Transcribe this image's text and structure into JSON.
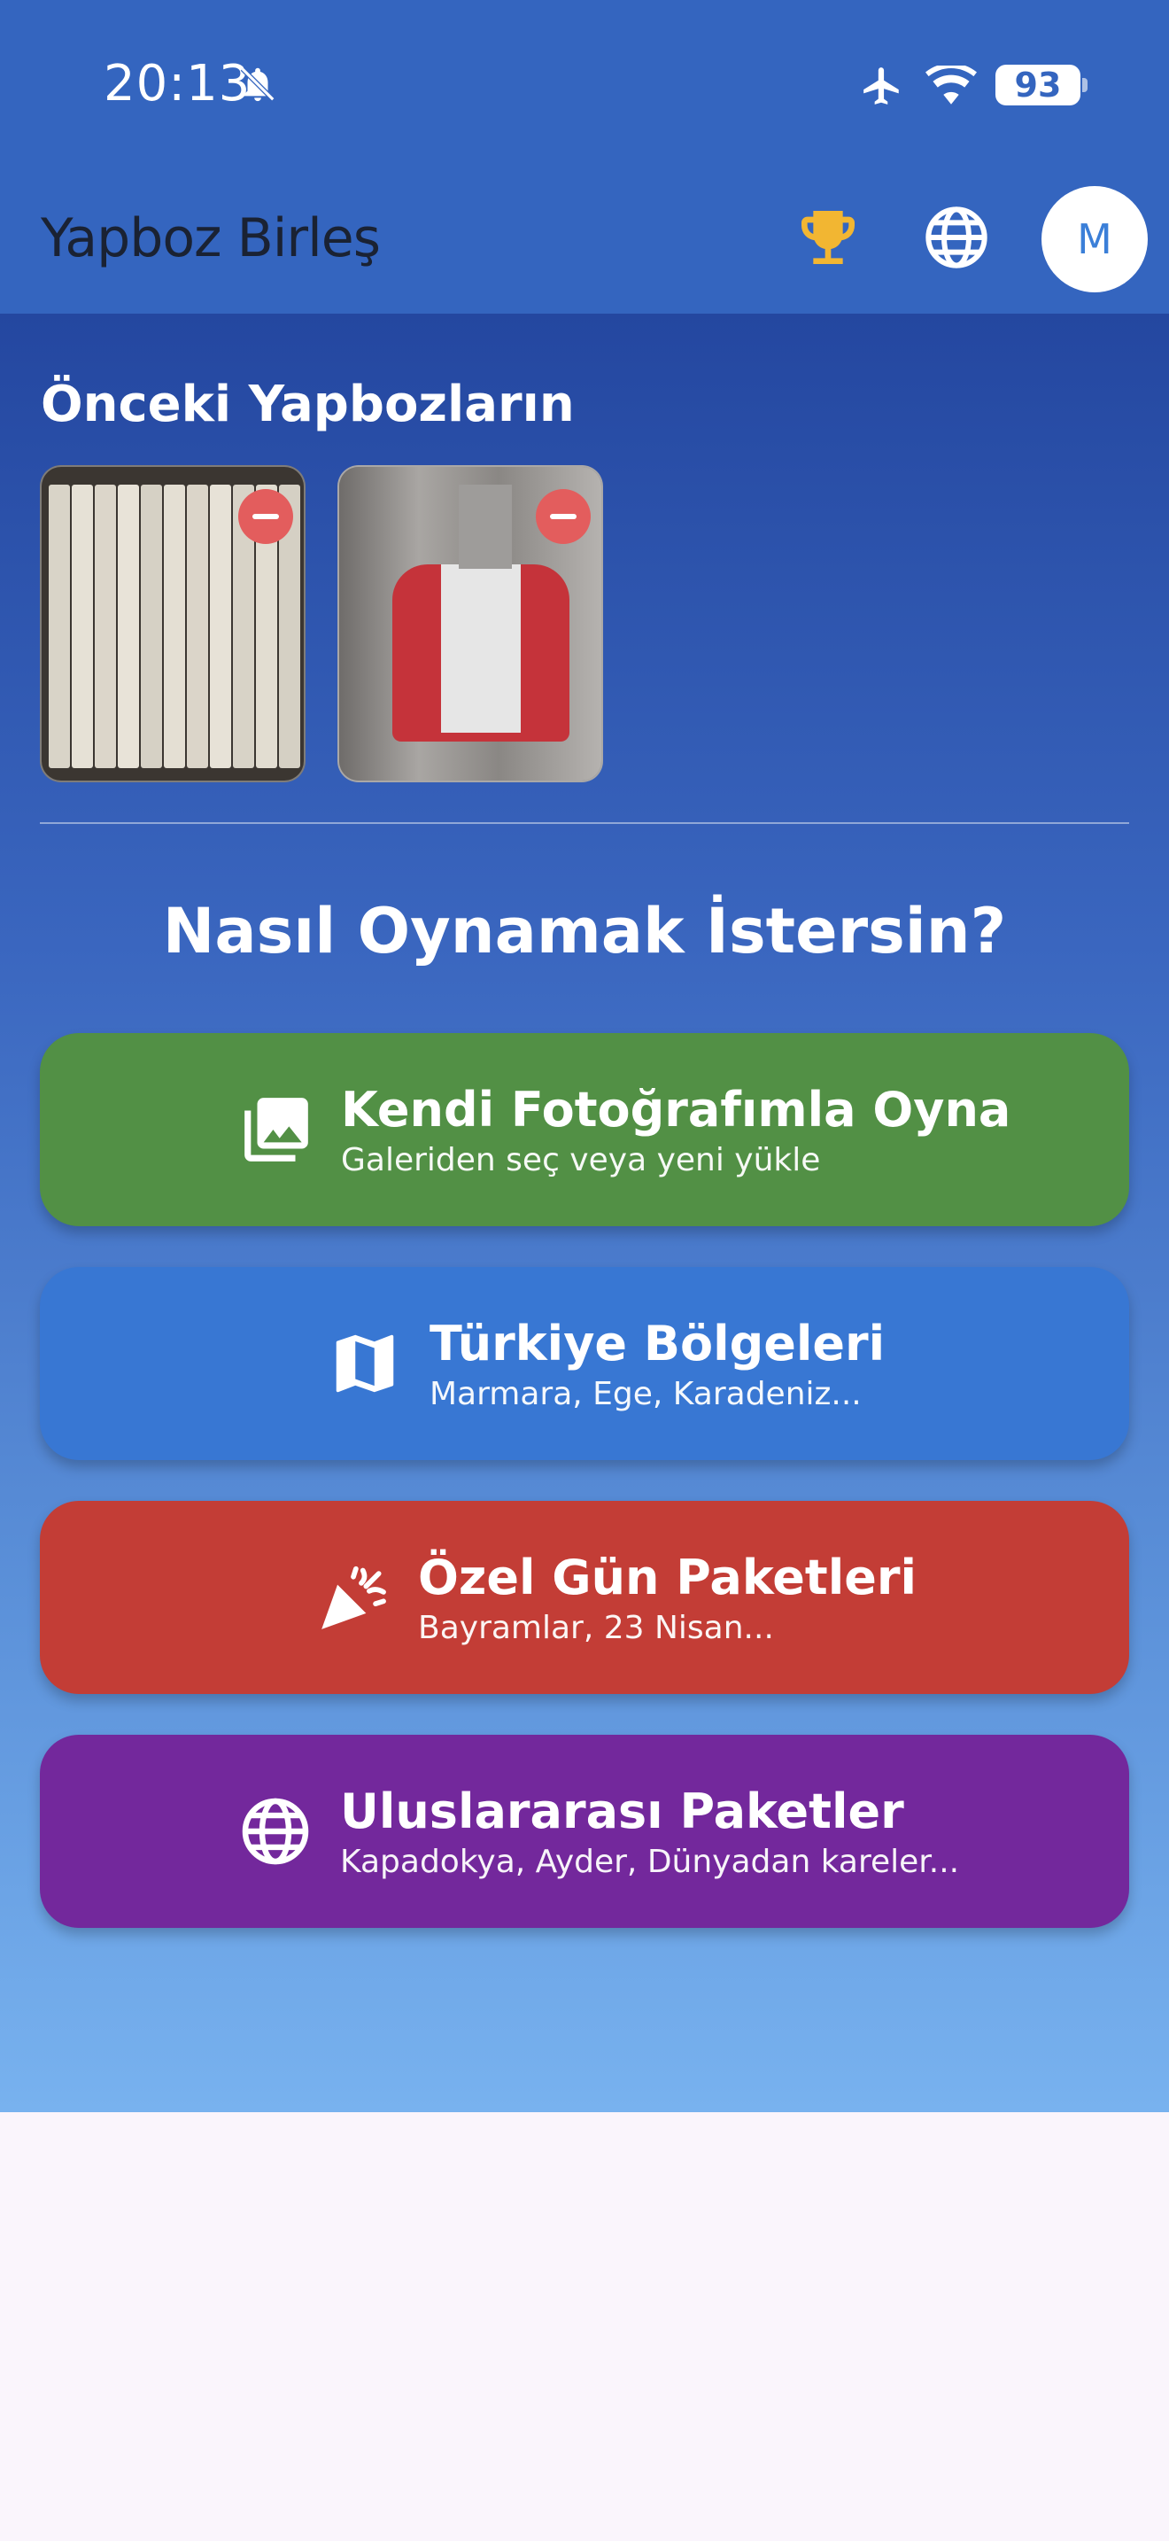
{
  "status_bar": {
    "time": "20:13",
    "battery": "93",
    "icons": [
      "bell-off-icon",
      "airplane-icon",
      "wifi-icon",
      "battery-icon"
    ]
  },
  "app_bar": {
    "title": "Yapboz Birleş",
    "avatar_initial": "M",
    "icons": [
      "trophy-icon",
      "globe-icon"
    ],
    "trophy_color": "#f2b632"
  },
  "previous": {
    "title": "Önceki Yapbozların",
    "items": [
      {
        "kind": "photo",
        "remove_icon": "remove-icon"
      },
      {
        "kind": "photo",
        "remove_icon": "remove-icon"
      }
    ]
  },
  "question": "Nasıl Oynamak İstersin?",
  "options": [
    {
      "title": "Kendi Fotoğrafımla Oyna",
      "subtitle": "Galeriden seç veya yeni yükle",
      "icon": "photo-library-icon",
      "color": "#529045"
    },
    {
      "title": "Türkiye Bölgeleri",
      "subtitle": "Marmara, Ege, Karadeniz...",
      "icon": "map-icon",
      "color": "#3877d3"
    },
    {
      "title": "Özel Gün Paketleri",
      "subtitle": "Bayramlar, 23 Nisan...",
      "icon": "celebration-icon",
      "color": "#c33d36"
    },
    {
      "title": "Uluslararası Paketler",
      "subtitle": "Kapadokya, Ayder, Dünyadan kareler...",
      "icon": "globe-icon",
      "color": "#73289c"
    }
  ]
}
